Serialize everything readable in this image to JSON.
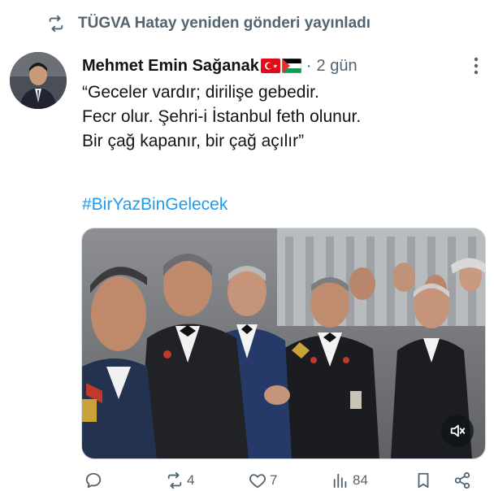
{
  "repost": {
    "icon": "retweet-icon",
    "text": "TÜGVA Hatay yeniden gönderi yayınladı"
  },
  "tweet": {
    "author_name": "Mehmet Emin Sağanak",
    "flags": [
      "turkey-flag-icon",
      "palestine-flag-icon"
    ],
    "separator": "·",
    "time": "2 gün",
    "text_lines": [
      "“Geceler vardır; dirilişe gebedir.",
      "Fecr olur. Şehri-i İstanbul feth olunur.",
      "Bir çağ kapanır, bir çağ açılır”"
    ],
    "hashtag": "#BirYazBinGelecek"
  },
  "actions": {
    "reply": {
      "icon": "reply-icon",
      "count": ""
    },
    "retweet": {
      "icon": "retweet-icon",
      "count": "4"
    },
    "like": {
      "icon": "heart-icon",
      "count": "7"
    },
    "views": {
      "icon": "views-icon",
      "count": "84"
    },
    "bookmark": {
      "icon": "bookmark-icon"
    },
    "share": {
      "icon": "share-icon"
    }
  },
  "colors": {
    "link": "#1d9bf0",
    "secondary": "#536471",
    "text": "#0f1419"
  }
}
